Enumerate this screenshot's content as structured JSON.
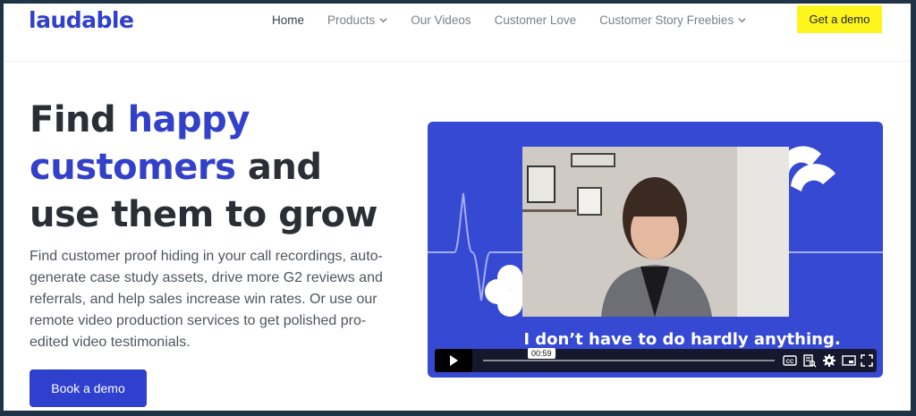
{
  "brand": {
    "logo_text": "laudable",
    "color": "#2f3fce"
  },
  "nav": {
    "items": [
      {
        "label": "Home",
        "active": true,
        "dropdown": false
      },
      {
        "label": "Products",
        "active": false,
        "dropdown": true
      },
      {
        "label": "Our Videos",
        "active": false,
        "dropdown": false
      },
      {
        "label": "Customer Love",
        "active": false,
        "dropdown": false
      },
      {
        "label": "Customer Story Freebies",
        "active": false,
        "dropdown": true
      }
    ],
    "cta_label": "Get a demo",
    "cta_color": "#fdf51c"
  },
  "hero": {
    "title_line1_plain": "Find ",
    "title_line1_highlight": "happy",
    "title_line2_highlight": "customers",
    "title_line2_plain": " and",
    "title_line3_plain": "use them to grow",
    "highlight_color": "#3340c9",
    "description": "Find customer proof hiding in your call recordings, auto-generate case study assets, drive more G2 reviews and referrals, and help sales increase win rates. Or use our remote video production services to get polished pro-edited video testimonials.",
    "button_label": "Book a demo"
  },
  "video": {
    "caption": "I don’t have to do hardly anything.",
    "timestamp": "00:59",
    "progress": 0.0,
    "background_color": "#3649d3",
    "icons": [
      "play-icon",
      "closed-captions-icon",
      "transcript-icon",
      "settings-gear-icon",
      "picture-in-picture-icon",
      "fullscreen-icon"
    ]
  }
}
